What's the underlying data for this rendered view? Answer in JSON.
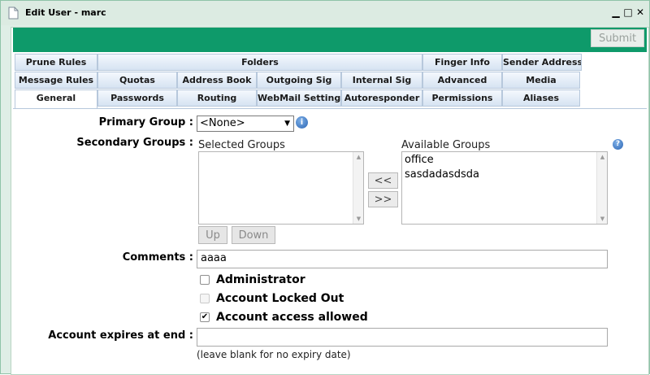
{
  "window": {
    "title": "Edit User - marc",
    "controls": {
      "minimize": "▁",
      "maximize": "□",
      "close": "✕"
    }
  },
  "toolbar": {
    "submit_label": "Submit"
  },
  "tabs": {
    "row1": [
      "Prune Rules",
      "Folders",
      "Finger Info",
      "Sender Address"
    ],
    "row2": [
      "Message Rules",
      "Quotas",
      "Address Book",
      "Outgoing Sig",
      "Internal Sig",
      "Advanced",
      "Media"
    ],
    "row3": [
      "General",
      "Passwords",
      "Routing",
      "WebMail Settings",
      "Autoresponder",
      "Permissions",
      "Aliases"
    ],
    "active": "General"
  },
  "form": {
    "primary_group": {
      "label": "Primary Group :",
      "selected": "<None>"
    },
    "secondary_groups": {
      "label": "Secondary Groups :",
      "selected_caption": "Selected Groups",
      "available_caption": "Available Groups",
      "selected_items": [],
      "available_items": [
        "office",
        "sasdadasdsda"
      ],
      "add_button": "<<",
      "remove_button": ">>",
      "up_button": "Up",
      "down_button": "Down"
    },
    "comments": {
      "label": "Comments :",
      "value": "aaaa"
    },
    "administrator": {
      "label": "Administrator",
      "checked": false
    },
    "account_locked_out": {
      "label": "Account Locked Out",
      "checked": false,
      "disabled": true
    },
    "account_access_allowed": {
      "label": "Account access allowed",
      "checked": true
    },
    "account_expires": {
      "label": "Account expires at end :",
      "value": "",
      "hint": "(leave blank for no expiry date)"
    }
  },
  "colors": {
    "header_green": "#0e9a6a",
    "tab_blue": "#d6e3f2",
    "info_blue": "#2a64b3"
  }
}
